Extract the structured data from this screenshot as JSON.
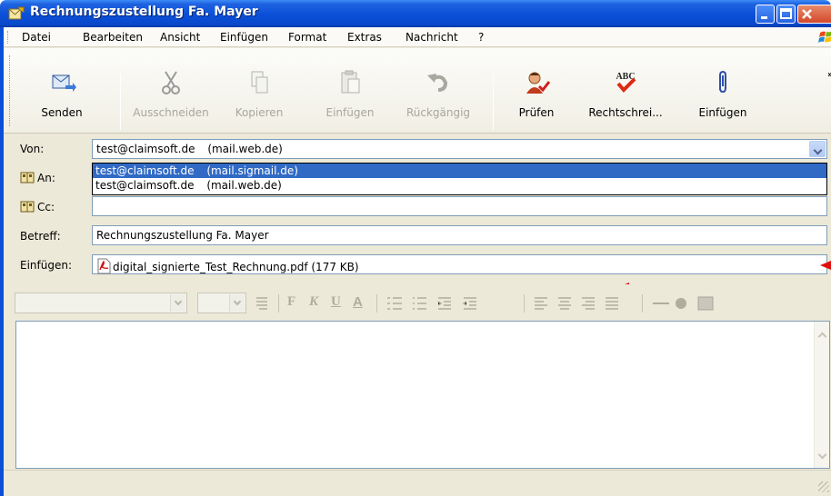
{
  "window": {
    "title": "Rechnungszustellung Fa. Mayer",
    "titlebar_color": "#0a4fd8"
  },
  "menu": {
    "items": [
      "Datei",
      "Bearbeiten",
      "Ansicht",
      "Einfügen",
      "Format",
      "Extras",
      "Nachricht",
      "?"
    ]
  },
  "toolbar": {
    "buttons": [
      {
        "label": "Senden",
        "icon": "send-icon",
        "enabled": true
      },
      {
        "label": "Ausschneiden",
        "icon": "scissors-icon",
        "enabled": false
      },
      {
        "label": "Kopieren",
        "icon": "copy-icon",
        "enabled": false
      },
      {
        "label": "Einfügen",
        "icon": "paste-icon",
        "enabled": false
      },
      {
        "label": "Rückgängig",
        "icon": "undo-icon",
        "enabled": false
      },
      {
        "label": "Prüfen",
        "icon": "check-names-icon",
        "enabled": true
      },
      {
        "label": "Rechtschrei...",
        "icon": "spellcheck-icon",
        "enabled": true
      },
      {
        "label": "Einfügen",
        "icon": "paperclip-icon",
        "enabled": true
      }
    ],
    "overflow_glyph": "»"
  },
  "header": {
    "from": {
      "label": "Von:",
      "value_address": "test@claimsoft.de",
      "value_account": "(mail.web.de)"
    },
    "from_options": [
      {
        "address": "test@claimsoft.de",
        "account": "(mail.sigmail.de)",
        "selected": true
      },
      {
        "address": "test@claimsoft.de",
        "account": "(mail.web.de)",
        "selected": false
      }
    ],
    "to": {
      "label": "An:",
      "value": ""
    },
    "cc": {
      "label": "Cc:",
      "value": ""
    },
    "subject": {
      "label": "Betreff:",
      "value": "Rechnungszustellung Fa. Mayer"
    },
    "attach": {
      "label": "Einfügen:",
      "value": "digital_signierte_Test_Rechnung.pdf (177 KB)"
    }
  },
  "format_toolbar": {
    "glyphs": [
      "F",
      "K",
      "U",
      "A"
    ]
  },
  "body": {
    "text": ""
  },
  "colors": {
    "highlight": "#316ac5",
    "annotation_arrow": "#e01010"
  }
}
